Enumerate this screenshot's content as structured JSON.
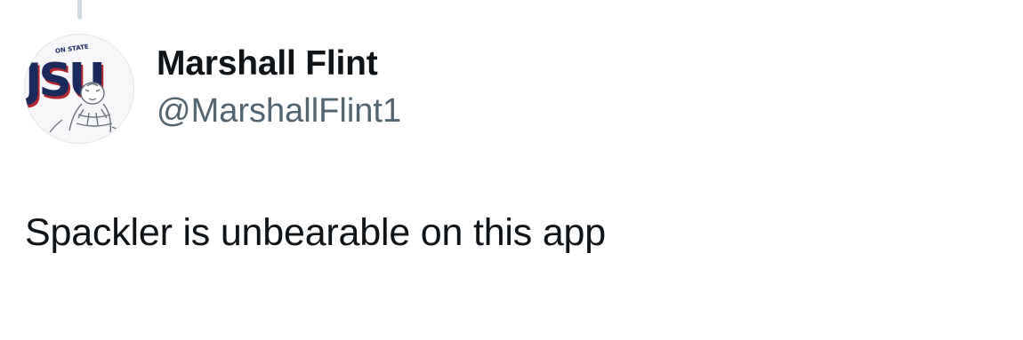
{
  "tweet": {
    "display_name": "Marshall Flint",
    "handle": "@MarshallFlint1",
    "text": "Spackler is unbearable on this app",
    "meta_partial": "",
    "avatar": {
      "icon": "jsu-tiger-logo-icon",
      "logo_text": "JSU",
      "arc_text": "ON STATE",
      "colors": {
        "navy": "#1a2a5c",
        "red": "#b3262e",
        "sketch": "#6b7280"
      }
    }
  },
  "colors": {
    "text_primary": "#0f1419",
    "text_secondary": "#536471",
    "thread_line": "#cfd9de"
  }
}
